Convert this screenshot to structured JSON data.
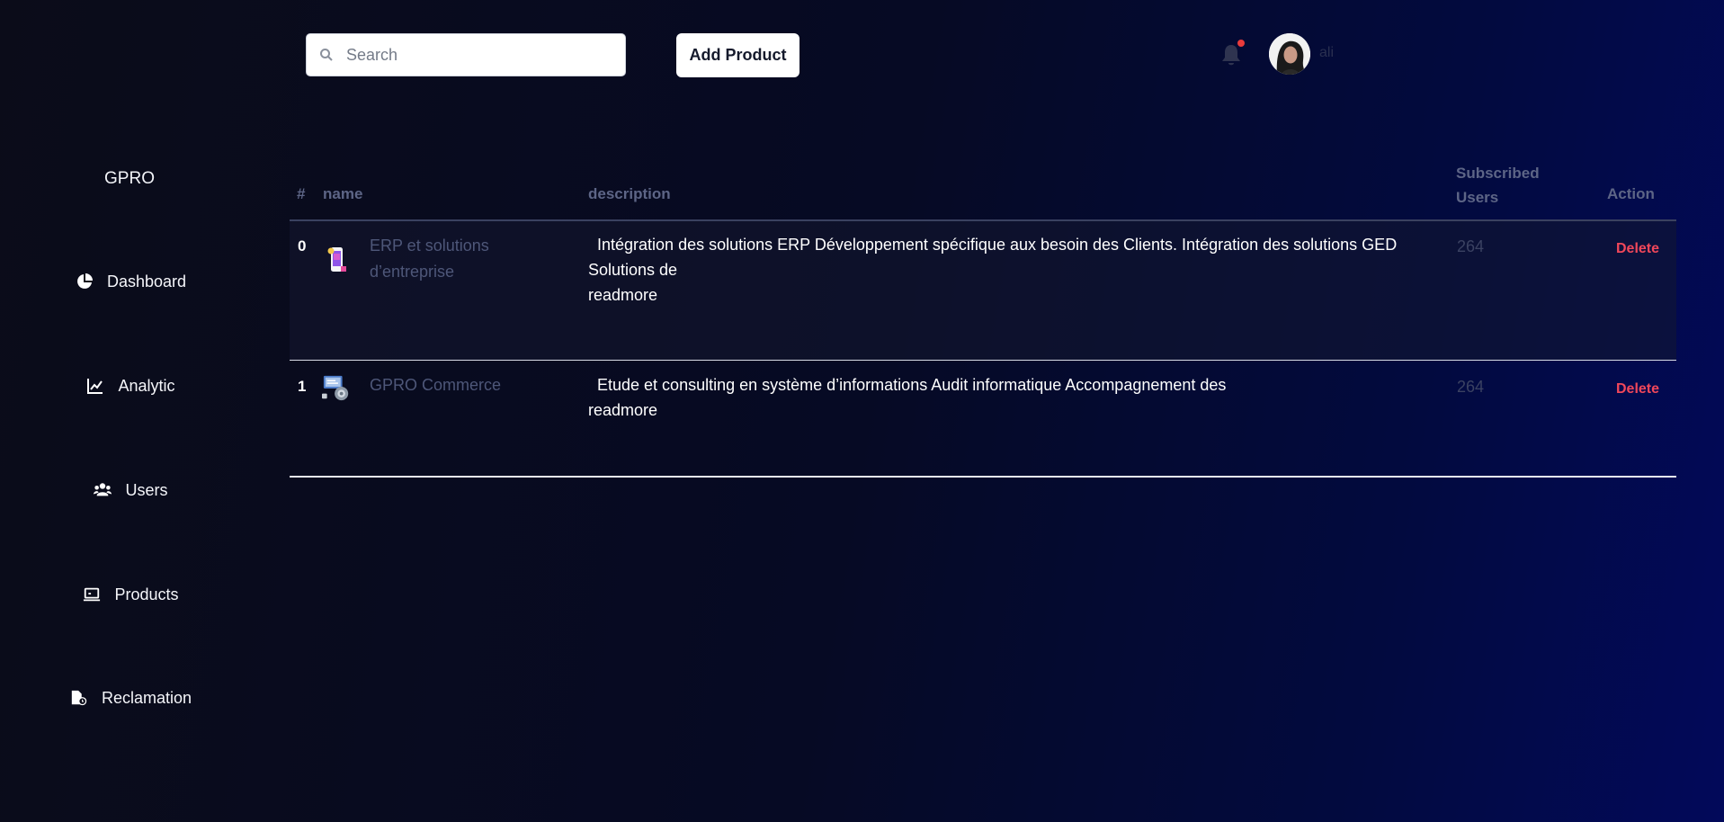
{
  "sidebar": {
    "brand": "GPRO",
    "items": [
      {
        "label": "Dashboard",
        "icon": "pie-chart-icon"
      },
      {
        "label": "Analytic",
        "icon": "line-chart-icon"
      },
      {
        "label": "Users",
        "icon": "users-icon"
      },
      {
        "label": "Products",
        "icon": "laptop-icon"
      },
      {
        "label": "Reclamation",
        "icon": "file-clock-icon"
      }
    ]
  },
  "header": {
    "search_placeholder": "Search",
    "add_product_label": "Add Product",
    "username": "ali",
    "notification_dot_color": "#ea3b3b"
  },
  "table": {
    "columns": [
      "#",
      "name",
      "description",
      "Subscribed Users",
      "Action"
    ],
    "columns_split": {
      "subscribed_line1": "Subscribed",
      "subscribed_line2": "Users"
    },
    "rows": [
      {
        "index": "0",
        "name_line1": "ERP et solutions",
        "name_line2": "d’entreprise",
        "desc_line1": "  Intégration des solutions ERP Développement spécifique aux besoin des Clients. Intégration des solutions GED",
        "desc_line2": "Solutions de",
        "readmore": "readmore",
        "subscribed": "264",
        "action": "Delete"
      },
      {
        "index": "1",
        "name_line1": "GPRO Commerce",
        "desc_line1": "  Etude et consulting en système d’informations Audit informatique Accompagnement des",
        "readmore": "readmore",
        "subscribed": "264",
        "action": "Delete"
      }
    ]
  },
  "colors": {
    "delete": "#f0475a",
    "header_text": "#5d6586"
  }
}
